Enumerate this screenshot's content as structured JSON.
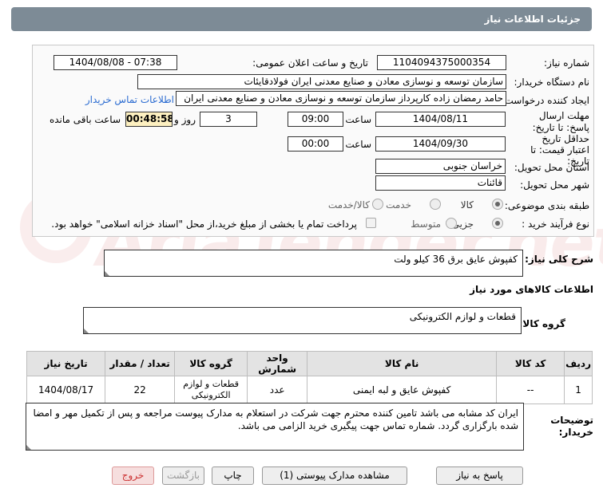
{
  "header": {
    "title": "جزئیات اطلاعات نیاز"
  },
  "watermark": {
    "text": "AriaTender.net"
  },
  "form": {
    "need_number_label": "شماره نیاز:",
    "need_number": "1104094375000354",
    "announce_label": "تاریخ و ساعت اعلان عمومی:",
    "announce_value": "1404/08/08 - 07:38",
    "buyer_org_label": "نام دستگاه خریدار:",
    "buyer_org": "سازمان توسعه و نوسازی معادن و صنایع معدنی ایران فولادقایئات",
    "creator_label": "ایجاد کننده درخواست:",
    "creator": "حامد  رمضان زاده  کارپرداز  سازمان توسعه و نوسازی معادن و صنایع معدنی ایران",
    "contact_link": "اطلاعات تماس خریدار",
    "reply_deadline_label": "مهلت ارسال پاسخ: تا تاریخ:",
    "reply_date": "1404/08/11",
    "time_label": "ساعت",
    "reply_time": "09:00",
    "days": "3",
    "days_label": "روز و",
    "remaining": "00:48:58",
    "remaining_label": "ساعت باقی مانده",
    "validity_label": "حداقل تاریخ اعتبار قیمت: تا تاریخ:",
    "validity_date": "1404/09/30",
    "validity_time": "00:00",
    "province_label": "استان محل تحویل:",
    "province": "خراسان جنوبی",
    "city_label": "شهر محل تحویل:",
    "city": "قائنات",
    "category_label": "طبقه بندی موضوعی:",
    "category_options": [
      "کالا",
      "خدمت",
      "کالا/خدمت"
    ],
    "process_label": "نوع فرآیند خرید :",
    "process_options": [
      "جزیی",
      "متوسط"
    ],
    "payment_note": "پرداخت تمام یا بخشی از مبلغ خرید،از محل \"اسناد خزانه اسلامی\" خواهد بود."
  },
  "need_desc": {
    "label": "شرح کلی نیاز:",
    "value": "کفپوش عایق برق 36 کیلو ولت"
  },
  "goods_info_label": "اطلاعات کالاهای مورد نیاز",
  "goods_group": {
    "label": "گروه کالا:",
    "value": "قطعات و لوازم الکترونیکی"
  },
  "table": {
    "headers": [
      "ردیف",
      "کد کالا",
      "نام کالا",
      "واحد شمارش",
      "گروه کالا",
      "تعداد / مقدار",
      "تاریخ نیاز"
    ],
    "rows": [
      [
        "1",
        "--",
        "کفپوش عایق و لبه ایمنی",
        "عدد",
        "قطعات و لوازم الکترونیکی",
        "22",
        "1404/08/17"
      ]
    ]
  },
  "buyer_notes": {
    "label": "توضیحات خریدار:",
    "value": "ایران کد مشابه می باشد تامین کننده محترم جهت شرکت در استعلام به مدارک پیوست مراجعه و پس از تکمیل مهر و امضا شده بارگزاری گردد. شماره تماس جهت پیگیری خرید الزامی می باشد."
  },
  "buttons": {
    "reply": "پاسخ به نیاز",
    "attachments": "مشاهده مدارک پیوستی (1)",
    "print": "چاپ",
    "back": "بازگشت",
    "exit": "خروج"
  }
}
